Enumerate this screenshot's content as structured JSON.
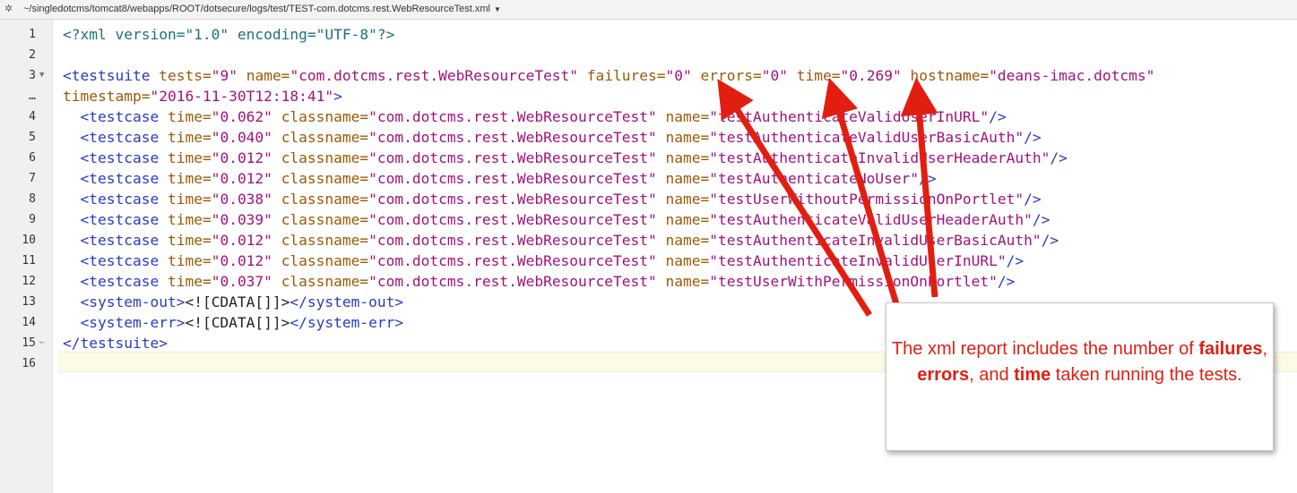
{
  "window": {
    "file_path": "~/singledotcms/tomcat8/webapps/ROOT/dotsecure/logs/test/TEST-com.dotcms.rest.WebResourceTest.xml",
    "settings_icon": "gear-icon",
    "dropdown_icon": "caret-down-icon"
  },
  "gutter": {
    "line_numbers": [
      "1",
      "2",
      "3",
      "…",
      "4",
      "5",
      "6",
      "7",
      "8",
      "9",
      "10",
      "11",
      "12",
      "13",
      "14",
      "15",
      "16"
    ],
    "fold_icons": {
      "3": "fold-open-icon",
      "15": "fold-close-icon"
    }
  },
  "code": {
    "line1": {
      "pi": "<?xml version=\"1.0\" encoding=\"UTF-8\"?>"
    },
    "line3": {
      "open": "<testsuite",
      "tests_attr": "tests=",
      "tests_val": "\"9\"",
      "name_attr": "name=",
      "name_val": "\"com.dotcms.rest.WebResourceTest\"",
      "failures_attr": "failures=",
      "failures_val": "\"0\"",
      "errors_attr": "errors=",
      "errors_val": "\"0\"",
      "time_attr": "time=",
      "time_val": "\"0.269\"",
      "hostname_attr": "hostname=",
      "hostname_val": "\"deans-imac.dotcms\""
    },
    "line3b": {
      "timestamp_attr": "timestamp=",
      "timestamp_val": "\"2016-11-30T12:18:41\"",
      "close": ">"
    },
    "testcase_labels": {
      "open": "<testcase",
      "time_attr": "time=",
      "classname_attr": "classname=",
      "name_attr": "name=",
      "close": "/>"
    },
    "testcases": [
      {
        "time": "\"0.062\"",
        "classname": "\"com.dotcms.rest.WebResourceTest\"",
        "name": "\"testAuthenticateValidUserInURL\""
      },
      {
        "time": "\"0.040\"",
        "classname": "\"com.dotcms.rest.WebResourceTest\"",
        "name": "\"testAuthenticateValidUserBasicAuth\""
      },
      {
        "time": "\"0.012\"",
        "classname": "\"com.dotcms.rest.WebResourceTest\"",
        "name": "\"testAuthenticateInvalidUserHeaderAuth\""
      },
      {
        "time": "\"0.012\"",
        "classname": "\"com.dotcms.rest.WebResourceTest\"",
        "name": "\"testAuthenticateNoUser\""
      },
      {
        "time": "\"0.038\"",
        "classname": "\"com.dotcms.rest.WebResourceTest\"",
        "name": "\"testUserWithoutPermissionOnPortlet\""
      },
      {
        "time": "\"0.039\"",
        "classname": "\"com.dotcms.rest.WebResourceTest\"",
        "name": "\"testAuthenticateValidUserHeaderAuth\""
      },
      {
        "time": "\"0.012\"",
        "classname": "\"com.dotcms.rest.WebResourceTest\"",
        "name": "\"testAuthenticateInvalidUserBasicAuth\""
      },
      {
        "time": "\"0.012\"",
        "classname": "\"com.dotcms.rest.WebResourceTest\"",
        "name": "\"testAuthenticateInvalidUserInURL\""
      },
      {
        "time": "\"0.037\"",
        "classname": "\"com.dotcms.rest.WebResourceTest\"",
        "name": "\"testUserWithPermissionOnPortlet\""
      }
    ],
    "line13": {
      "open": "<system-out>",
      "text": "<![CDATA[]]>",
      "close": "</system-out>"
    },
    "line14": {
      "open": "<system-err>",
      "text": "<![CDATA[]]>",
      "close": "</system-err>"
    },
    "line15": {
      "close": "</testsuite>"
    }
  },
  "callout": {
    "part1": "The xml report includes the number of ",
    "failures": "failures",
    "sep1": ", ",
    "errors": "errors",
    "sep2": ", and ",
    "time": "time",
    "part2": " taken running the tests."
  },
  "colors": {
    "annotation_red": "#e21e10",
    "tag_blue": "#2b39c8",
    "attr_brown": "#9a5a06",
    "value_magenta": "#a1127c",
    "pi_teal": "#1e6f7a"
  }
}
